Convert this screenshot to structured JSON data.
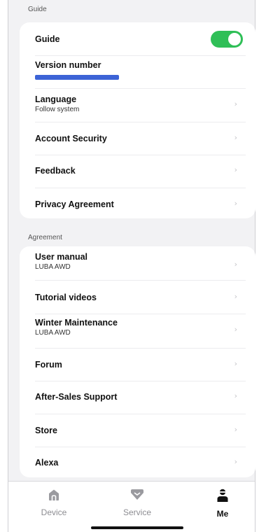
{
  "sections": {
    "top_label": "Guide",
    "second_label": "Agreement"
  },
  "settings": {
    "guide": {
      "label": "Guide",
      "enabled": true
    },
    "version": {
      "label": "Version number"
    },
    "language": {
      "label": "Language",
      "value": "Follow system"
    },
    "account_security": {
      "label": "Account Security"
    },
    "feedback": {
      "label": "Feedback"
    },
    "privacy": {
      "label": "Privacy Agreement"
    }
  },
  "agreement": {
    "user_manual": {
      "label": "User manual",
      "sub": "LUBA AWD"
    },
    "tutorial": {
      "label": "Tutorial videos"
    },
    "winter": {
      "label": "Winter Maintenance",
      "sub": "LUBA AWD"
    },
    "forum": {
      "label": "Forum"
    },
    "after_sales": {
      "label": "After-Sales Support"
    },
    "store": {
      "label": "Store"
    },
    "alexa": {
      "label": "Alexa"
    }
  },
  "chevron": "›",
  "tabs": {
    "device": {
      "label": "Device",
      "icon": "home-icon"
    },
    "service": {
      "label": "Service",
      "icon": "service-icon"
    },
    "me": {
      "label": "Me",
      "icon": "person-icon",
      "active": true
    }
  },
  "colors": {
    "toggle_on": "#2fbf57",
    "redaction": "#3c63d6"
  }
}
